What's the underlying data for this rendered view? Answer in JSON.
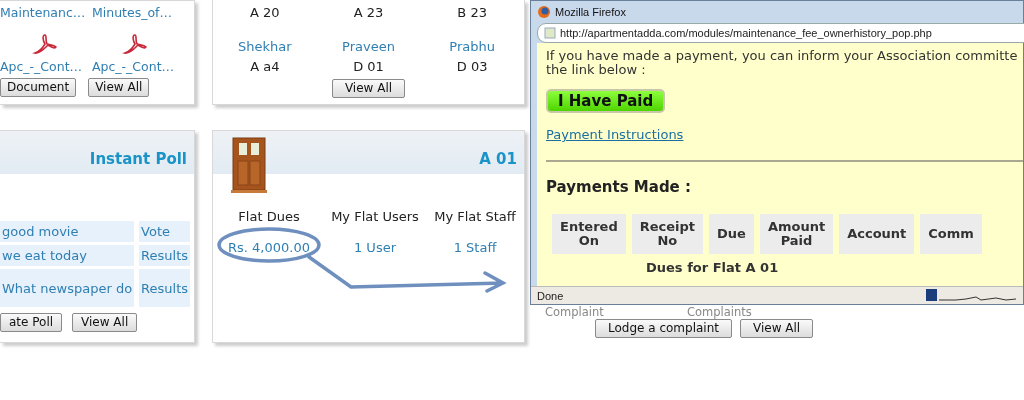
{
  "documents_card": {
    "files": [
      {
        "name": "Maintenanc…"
      },
      {
        "name": "Minutes_of…"
      }
    ],
    "pdf_files": [
      {
        "name": "Apc_-_Cont…"
      },
      {
        "name": "Apc_-_Cont…"
      }
    ],
    "buttons": [
      "Document",
      "View All"
    ]
  },
  "members_card": {
    "flats": [
      "A 20",
      "A 23",
      "B 23"
    ],
    "members": [
      {
        "name": "Shekhar",
        "flat": "A a4"
      },
      {
        "name": "Praveen",
        "flat": "D 01"
      },
      {
        "name": "Prabhu",
        "flat": "D 03"
      }
    ],
    "button": "View All"
  },
  "poll_card": {
    "title": "Instant Poll",
    "polls": [
      {
        "question": "good movie",
        "action": "Vote"
      },
      {
        "question": "we eat today",
        "action": "Results"
      },
      {
        "question": "What newspaper do",
        "action": "Results"
      }
    ],
    "buttons": [
      "ate Poll",
      "View All"
    ]
  },
  "flat_card": {
    "title": "A 01",
    "columns": [
      {
        "heading": "Flat Dues",
        "value": "Rs. 4,000.00",
        "circled": true
      },
      {
        "heading": "My Flat Users",
        "value": "1 User",
        "circled": false
      },
      {
        "heading": "My Flat Staff",
        "value": "1 Staff",
        "circled": false
      }
    ]
  },
  "popup": {
    "title": "Mozilla Firefox",
    "url": "http://apartmentadda.com/modules/maintenance_fee_ownerhistory_pop.php",
    "message_lines": [
      "If you have made a payment, you can inform your Association committe",
      "the link below :"
    ],
    "paid_button": "I Have Paid",
    "instructions_link": "Payment Instructions",
    "section_title": "Payments Made :",
    "table": {
      "columns": [
        "Entered On",
        "Receipt No",
        "Due",
        "Amount Paid",
        "Account",
        "Comm"
      ],
      "group_row": "Dues for Flat A 01"
    },
    "status": "Done"
  },
  "complaints": {
    "labels": [
      "Complaint",
      "Complaints"
    ],
    "buttons": [
      "Lodge a complaint",
      "View All"
    ]
  }
}
